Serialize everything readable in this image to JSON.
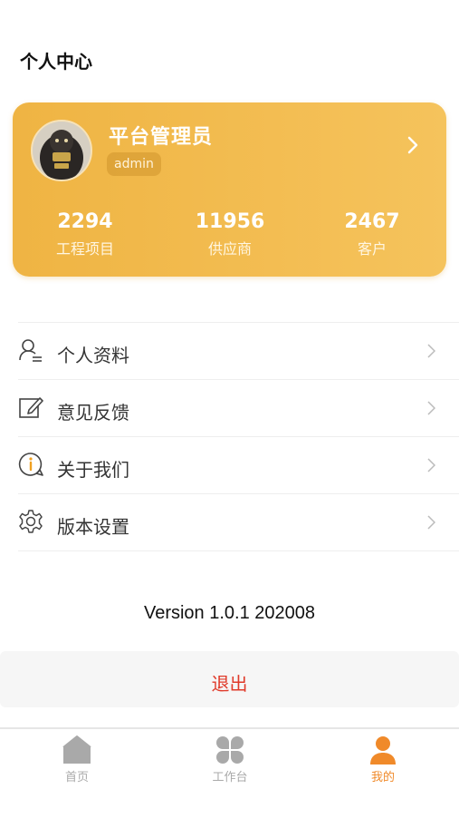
{
  "header": {
    "title": "个人中心"
  },
  "profile": {
    "name": "平台管理员",
    "role": "admin",
    "stats": [
      {
        "value": "2294",
        "label": "工程项目"
      },
      {
        "value": "11956",
        "label": "供应商"
      },
      {
        "value": "2467",
        "label": "客户"
      }
    ]
  },
  "menu": {
    "items": [
      {
        "label": "个人资料",
        "icon": "user-profile-icon"
      },
      {
        "label": "意见反馈",
        "icon": "edit-feedback-icon"
      },
      {
        "label": "关于我们",
        "icon": "info-icon"
      },
      {
        "label": "版本设置",
        "icon": "gear-icon"
      }
    ]
  },
  "footer": {
    "version": "Version 1.0.1 202008",
    "logout_label": "退出"
  },
  "tabbar": {
    "tabs": [
      {
        "label": "首页",
        "icon": "home-icon",
        "active": false
      },
      {
        "label": "工作台",
        "icon": "grid-clover-icon",
        "active": false
      },
      {
        "label": "我的",
        "icon": "person-icon",
        "active": true
      }
    ]
  },
  "colors": {
    "accent": "#f08a2a",
    "card": "#f2b94c",
    "logout": "#e03a2a",
    "inactive": "#aaaaaa"
  }
}
